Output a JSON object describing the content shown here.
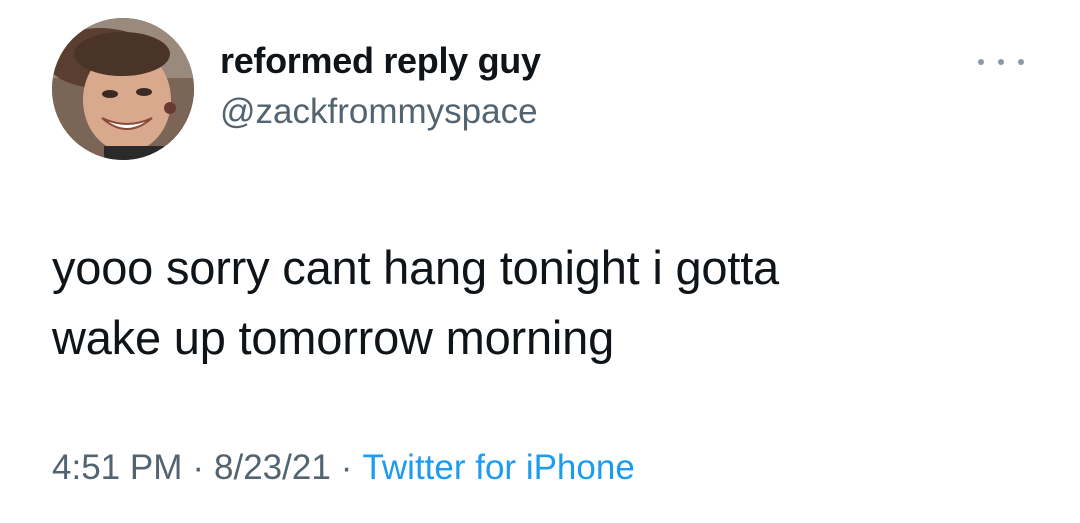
{
  "user": {
    "display_name": "reformed reply guy",
    "handle": "@zackfrommyspace",
    "avatar_icon": "profile-photo"
  },
  "more_icon": "ellipsis-icon",
  "tweet": {
    "lines": [
      "yooo sorry cant hang tonight i gotta",
      "wake up tomorrow morning"
    ]
  },
  "meta": {
    "time": "4:51 PM",
    "separator": "·",
    "date": "8/23/21",
    "source": "Twitter for iPhone"
  },
  "colors": {
    "text": "#0f1419",
    "secondary": "#536471",
    "link": "#1d9bf0",
    "background": "#ffffff"
  }
}
